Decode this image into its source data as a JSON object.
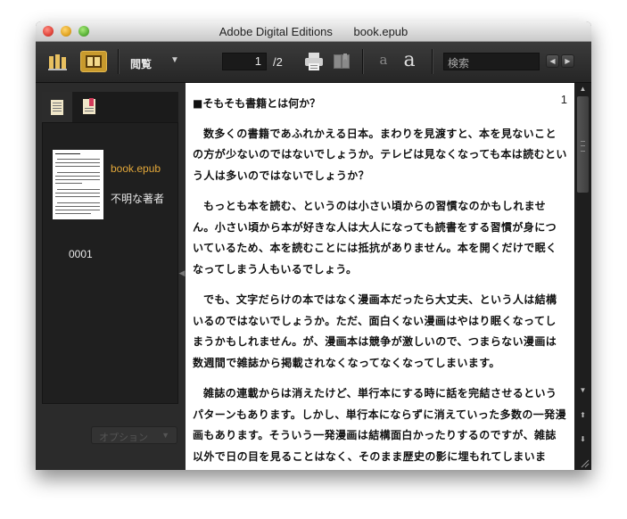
{
  "window": {
    "app_name": "Adobe Digital Editions",
    "document_name": "book.epub"
  },
  "toolbar": {
    "view_label": "閲覧",
    "page_current": "1",
    "page_total": "/2",
    "font_small": "a",
    "font_large": "a",
    "search_placeholder": "検索",
    "accent_color": "#c89a2d"
  },
  "sidebar": {
    "book_title": "book.epub",
    "author": "不明な著者",
    "chapter": "0001",
    "options_label": "オプション"
  },
  "page": {
    "page_number": "1",
    "heading": "■そもそも書籍とは何か？",
    "paragraphs": [
      "数多くの書籍であふれかえる日本。まわりを見渡すと、本を見ないことの方が少ないのではないでしょうか。テレビは見なくなっても本は読むという人は多いのではないでしょうか？",
      "もっとも本を読む、というのは小さい頃からの習慣なのかもしれません。小さい頃から本が好きな人は大人になっても読書をする習慣が身についているため、本を読むことには抵抗がありません。本を開くだけで眠くなってしまう人もいるでしょう。",
      "でも、文字だらけの本ではなく漫画本だったら大丈夫、という人は結構いるのではないでしょうか。ただ、面白くない漫画はやはり眠くなってしまうかもしれません。が、漫画本は競争が激しいので、つまらない漫画は数週間で雑誌から掲載されなくなってなくなってしまいます。",
      "雑誌の連載からは消えたけど、単行本にする時に話を完結させるというパターンもあります。しかし、単行本にならずに消えていった多数の一発漫画もあります。そういう一発漫画は結構面白かったりするのですが、雑誌以外で日の目を見ることはなく、そのまま歴史の影に埋もれてしまいます。"
    ]
  }
}
